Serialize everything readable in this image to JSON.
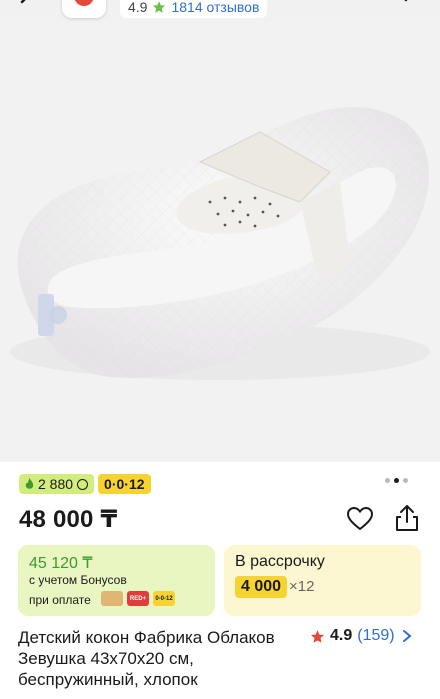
{
  "header": {
    "rating": "4.9",
    "reviews_link": "1814 отзывов"
  },
  "product": {
    "bonus_badge": "2 880",
    "installment_badge": "0·0·12",
    "price": "48 000 ₸",
    "title": "Детский кокон Фабрика Облаков Зевушка 43x70x20 см, беспружинный, хлопок",
    "rating": "4.9",
    "rating_count": "(159)"
  },
  "bonus_card": {
    "amount": "45 120 ₸",
    "line1": "с учетом Бонусов",
    "line2": "при оплате",
    "pay_labels": [
      "",
      "RED+",
      "0-0-12"
    ]
  },
  "installment_card": {
    "title": "В рассрочку",
    "monthly": "4 000",
    "multiplier": "×12"
  },
  "gallery": {
    "pages": 3,
    "active_index": 1
  },
  "colors": {
    "accent_green": "#d3ec7f",
    "accent_yellow": "#f7d332",
    "link_blue": "#2f6fd1",
    "star_red": "#e24a3b"
  }
}
